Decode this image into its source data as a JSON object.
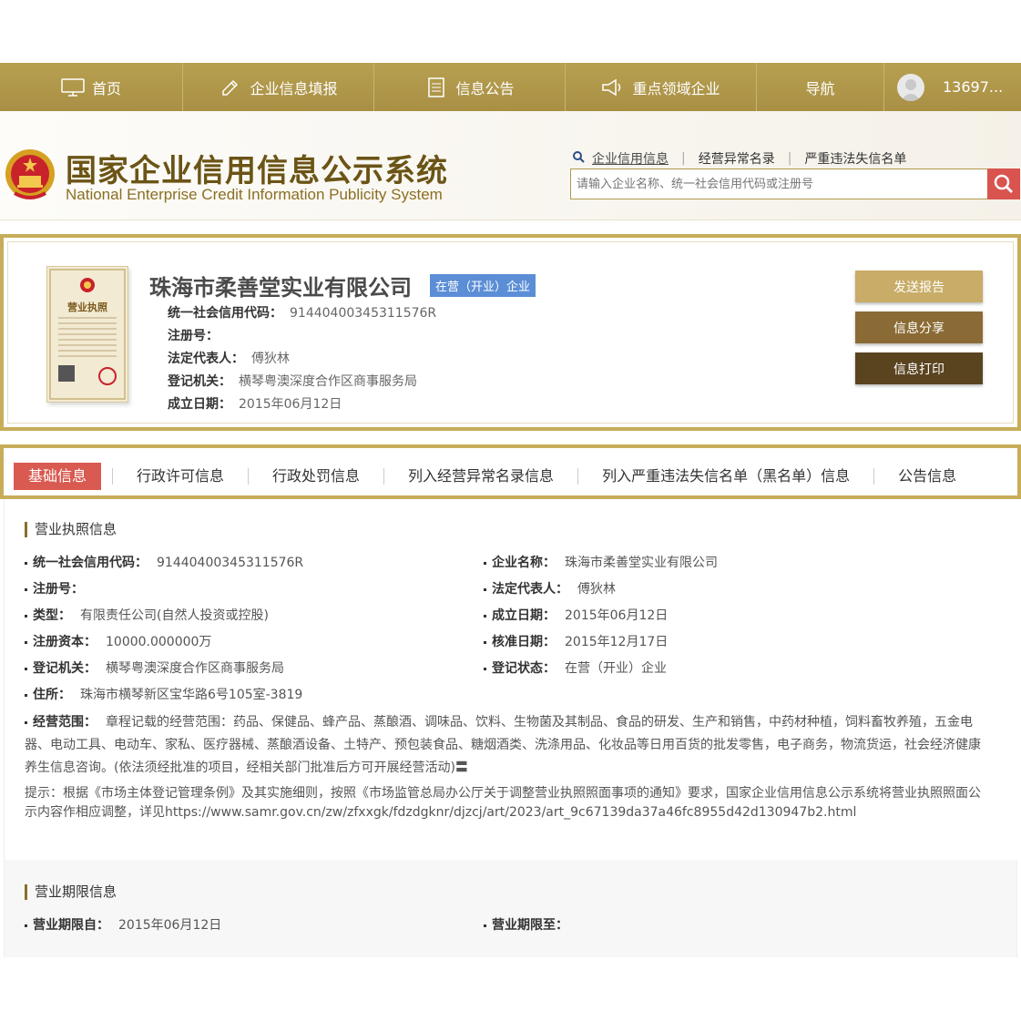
{
  "nav": {
    "items": [
      {
        "label": "首页",
        "icon": "monitor-icon"
      },
      {
        "label": "企业信息填报",
        "icon": "edit-icon"
      },
      {
        "label": "信息公告",
        "icon": "document-icon"
      },
      {
        "label": "重点领域企业",
        "icon": "megaphone-icon"
      },
      {
        "label": "导航",
        "icon": ""
      }
    ],
    "user": "13697..."
  },
  "header": {
    "title_cn": "国家企业信用信息公示系统",
    "title_en": "National Enterprise Credit Information Publicity System",
    "search_links": [
      "企业信用信息",
      "经营异常名录",
      "严重违法失信名单"
    ],
    "search_placeholder": "请输入企业名称、统一社会信用代码或注册号"
  },
  "company": {
    "name": "珠海市柔善堂实业有限公司",
    "status": "在营（开业）企业",
    "license_title": "营业执照",
    "lines": [
      {
        "label": "统一社会信用代码：",
        "value": "91440400345311576R"
      },
      {
        "label": "注册号：",
        "value": ""
      },
      {
        "label": "法定代表人：",
        "value": "傅狄林"
      },
      {
        "label": "登记机关：",
        "value": "横琴粤澳深度合作区商事服务局"
      },
      {
        "label": "成立日期：",
        "value": "2015年06月12日"
      }
    ],
    "actions": [
      {
        "label": "发送报告",
        "color": "#c8ac67"
      },
      {
        "label": "信息分享",
        "color": "#8b6b35"
      },
      {
        "label": "信息打印",
        "color": "#5a4420"
      }
    ]
  },
  "tabs": [
    "基础信息",
    "行政许可信息",
    "行政处罚信息",
    "列入经营异常名录信息",
    "列入严重违法失信名单（黑名单）信息",
    "公告信息"
  ],
  "license_section": {
    "title": "营业执照信息",
    "left": [
      {
        "label": "统一社会信用代码：",
        "value": "91440400345311576R"
      },
      {
        "label": "注册号：",
        "value": ""
      },
      {
        "label": "类型：",
        "value": "有限责任公司(自然人投资或控股)"
      },
      {
        "label": "注册资本：",
        "value": "10000.000000万"
      },
      {
        "label": "登记机关：",
        "value": "横琴粤澳深度合作区商事服务局"
      },
      {
        "label": "住所：",
        "value": "珠海市横琴新区宝华路6号105室-3819"
      }
    ],
    "right": [
      {
        "label": "企业名称：",
        "value": "珠海市柔善堂实业有限公司"
      },
      {
        "label": "法定代表人：",
        "value": "傅狄林"
      },
      {
        "label": "成立日期：",
        "value": "2015年06月12日"
      },
      {
        "label": "核准日期：",
        "value": "2015年12月17日"
      },
      {
        "label": "登记状态：",
        "value": "在营（开业）企业"
      }
    ],
    "scope_label": "经营范围：",
    "scope_value": "章程记载的经营范围：药品、保健品、蜂产品、蒸酿酒、调味品、饮料、生物菌及其制品、食品的研发、生产和销售，中药材种植，饲料畜牧养殖，五金电器、电动工具、电动车、家私、医疗器械、蒸酿酒设备、土特产、预包装食品、糖烟酒类、洗涤用品、化妆品等日用百货的批发零售，电子商务，物流货运，社会经济健康养生信息咨询。(依法须经批准的项目，经相关部门批准后方可开展经营活动)〓",
    "tip": "提示：根据《市场主体登记管理条例》及其实施细则，按照《市场监管总局办公厅关于调整营业执照照面事项的通知》要求，国家企业信用信息公示系统将营业执照照面公示内容作相应调整，详见https://www.samr.gov.cn/zw/zfxxgk/fdzdgknr/djzcj/art/2023/art_9c67139da37a46fc8955d42d130947b2.html"
  },
  "period_section": {
    "title": "营业期限信息",
    "from_label": "营业期限自：",
    "from_value": "2015年06月12日",
    "to_label": "营业期限至：",
    "to_value": ""
  }
}
